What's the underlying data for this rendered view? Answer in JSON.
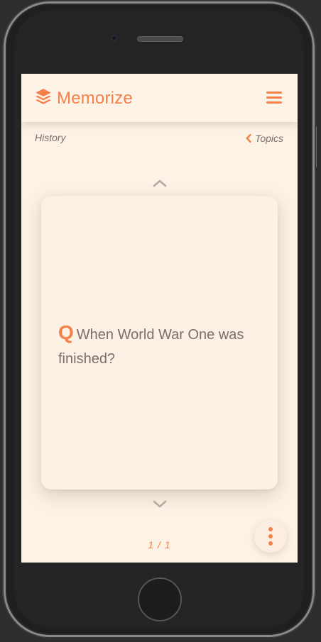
{
  "app": {
    "title": "Memorize",
    "accent_color": "#f6804a",
    "background_color": "#fcf2e6",
    "logo_icon": "layers-icon",
    "menu_icon": "hamburger-menu-icon"
  },
  "breadcrumb": {
    "topic": "History",
    "back_label": "Topics",
    "back_icon": "chevron-left-icon"
  },
  "card": {
    "marker": "Q",
    "question": "When World War One was finished?"
  },
  "navigation": {
    "prev_icon": "chevron-up-icon",
    "next_icon": "chevron-down-icon"
  },
  "pagination": {
    "label": "1 / 1"
  },
  "fab": {
    "icon": "more-vertical-icon"
  }
}
